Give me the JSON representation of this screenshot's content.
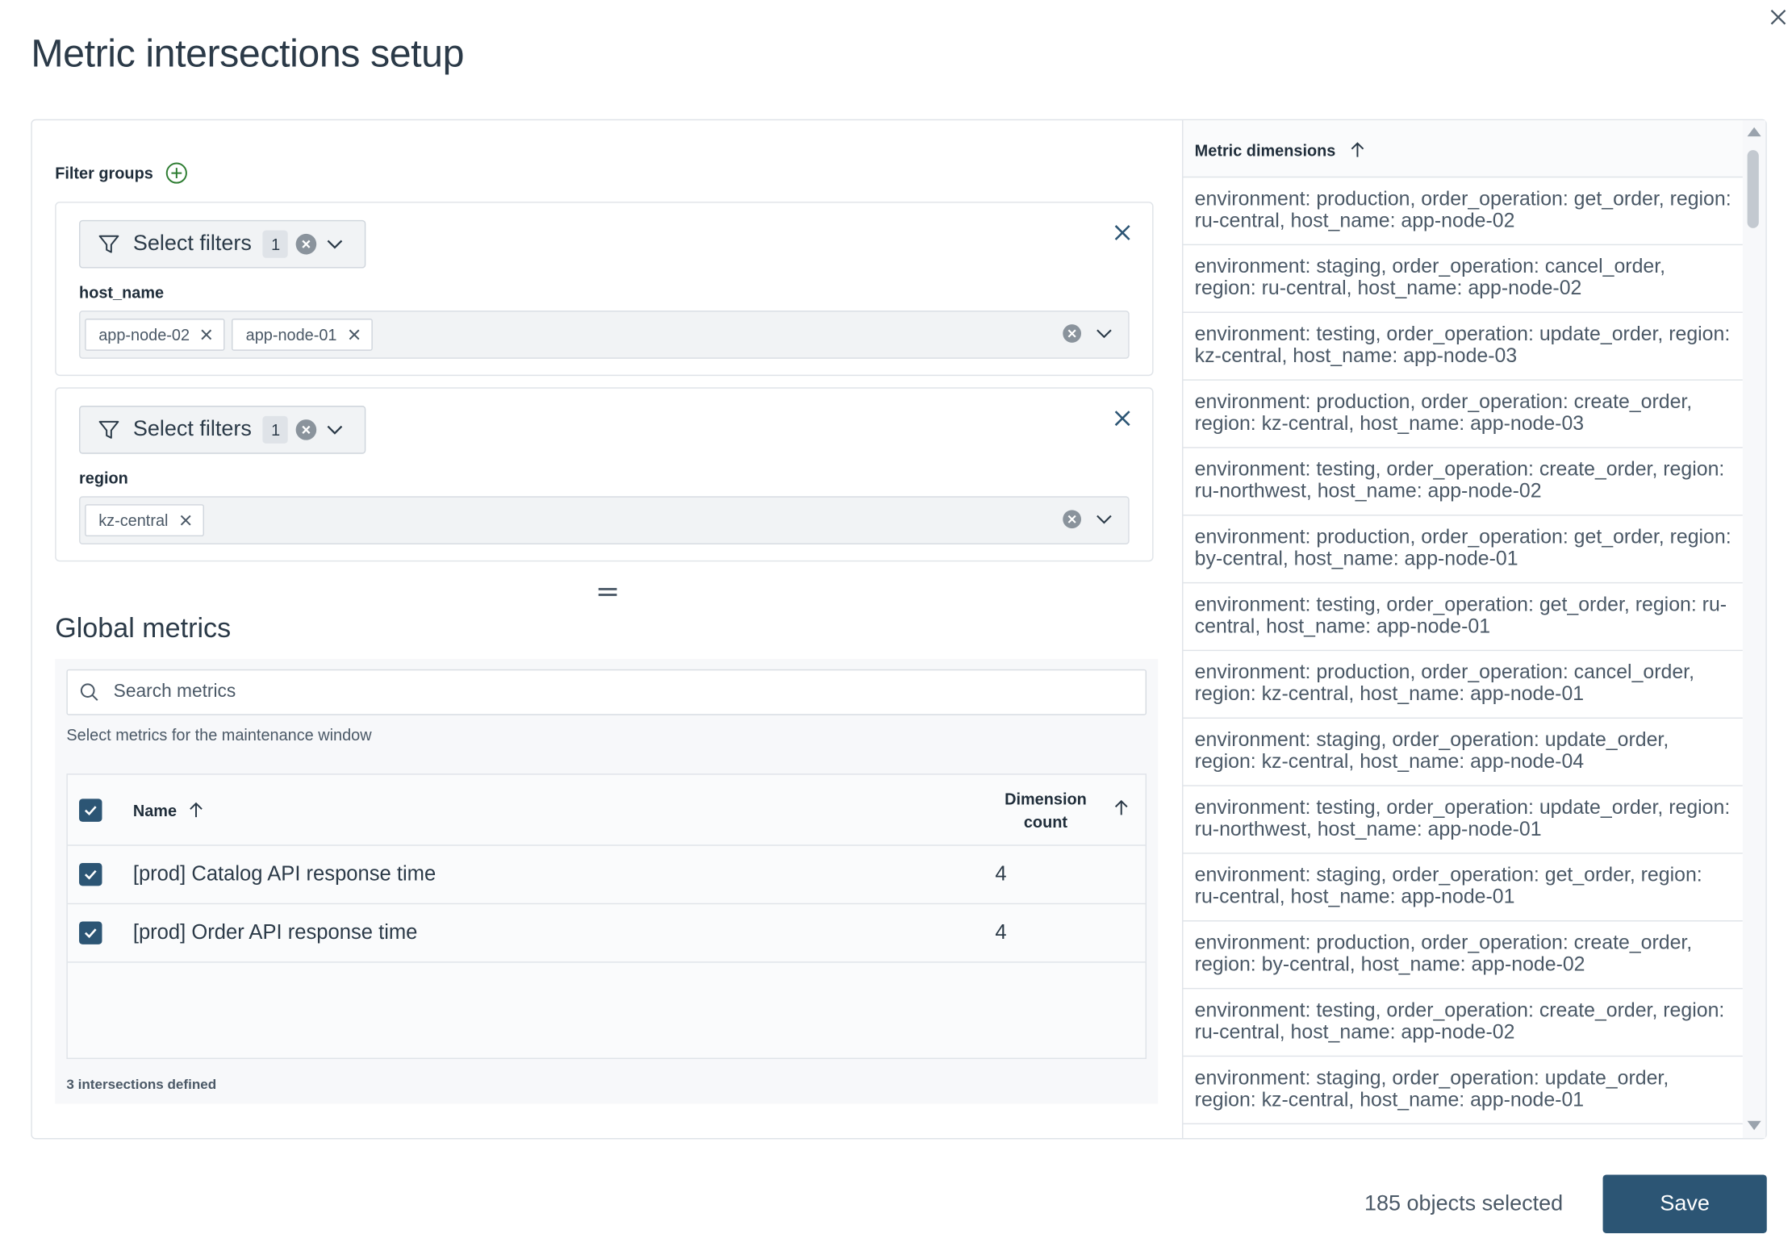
{
  "dialog": {
    "title": "Metric intersections setup",
    "close_icon": "close-icon"
  },
  "filter_groups": {
    "title": "Filter groups",
    "add_icon": "plus-circle-icon",
    "groups": [
      {
        "select_label": "Select filters",
        "count": "1",
        "field": "host_name",
        "tags": [
          "app-node-02",
          "app-node-01"
        ]
      },
      {
        "select_label": "Select filters",
        "count": "1",
        "field": "region",
        "tags": [
          "kz-central"
        ]
      }
    ]
  },
  "global_metrics": {
    "title": "Global metrics",
    "search_placeholder": "Search metrics",
    "hint": "Select metrics for the maintenance window",
    "columns": {
      "name": "Name",
      "dimension_count": "Dimension count"
    },
    "rows": [
      {
        "name": "[prod] Catalog API response time",
        "count": "4",
        "checked": true
      },
      {
        "name": "[prod] Order API response time",
        "count": "4",
        "checked": true
      }
    ],
    "intersections": "3 intersections defined"
  },
  "metric_dimensions": {
    "title": "Metric dimensions",
    "items": [
      "environment: production, order_operation: get_order, region: ru-central, host_name: app-node-02",
      "environment: staging, order_operation: cancel_order, region: ru-central, host_name: app-node-02",
      "environment: testing, order_operation: update_order, region: kz-central, host_name: app-node-03",
      "environment: production, order_operation: create_order, region: kz-central, host_name: app-node-03",
      "environment: testing, order_operation: create_order, region: ru-northwest, host_name: app-node-02",
      "environment: production, order_operation: get_order, region: by-central, host_name: app-node-01",
      "environment: testing, order_operation: get_order, region: ru-central, host_name: app-node-01",
      "environment: production, order_operation: cancel_order, region: kz-central, host_name: app-node-01",
      "environment: staging, order_operation: update_order, region: kz-central, host_name: app-node-04",
      "environment: testing, order_operation: update_order, region: ru-northwest, host_name: app-node-01",
      "environment: staging, order_operation: get_order, region: ru-central, host_name: app-node-01",
      "environment: production, order_operation: create_order, region: by-central, host_name: app-node-02",
      "environment: testing, order_operation: create_order, region: ru-central, host_name: app-node-02",
      "environment: staging, order_operation: update_order, region: kz-central, host_name: app-node-01"
    ]
  },
  "footer": {
    "selected": "185 objects selected",
    "save_label": "Save"
  },
  "colors": {
    "primary": "#2c5574",
    "accent_green": "#2e7d32",
    "border": "#dfe3e8"
  }
}
